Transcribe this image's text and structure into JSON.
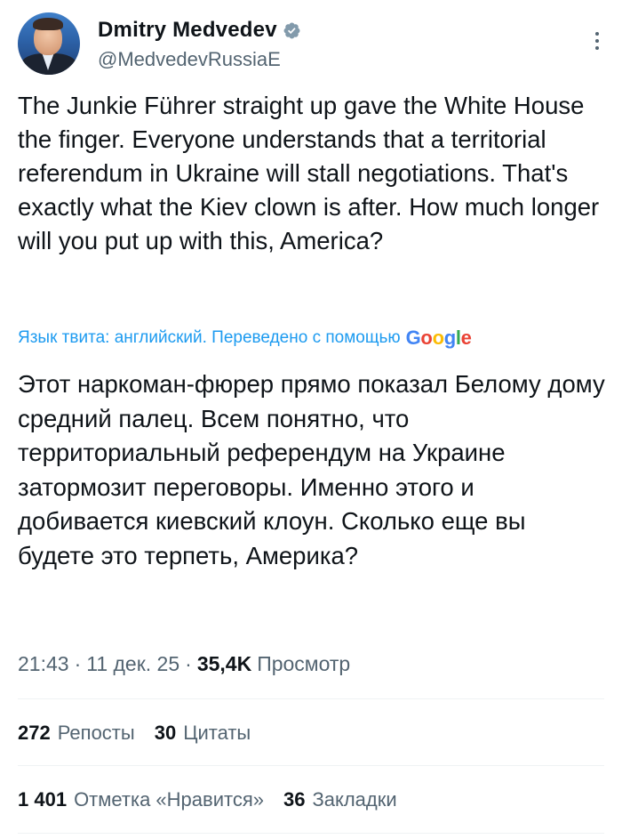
{
  "author": {
    "display_name": "Dmitry Medvedev",
    "handle": "@MedvedevRussiaE",
    "verified": true
  },
  "icons": {
    "avatar": "avatar-photo",
    "verified": "verified-badge-icon",
    "more": "more-options-icon"
  },
  "tweet": {
    "text": "The Junkie Führer straight up gave the White House the finger. Everyone understands that a territorial referendum in Ukraine will stall negotiations. That's exactly what the Kiev clown is after. How much longer will you put up with this, America?",
    "translation_notice": "Язык твита: английский. Переведено с помощью",
    "translation_provider": "Google",
    "translated_text": "Этот наркоман-фюрер прямо показал Белому дому средний палец. Всем понятно, что территориальный референдум на Украине затормозит переговоры. Именно этого и добивается киевский клоун. Сколько еще вы будете это терпеть, Америка?"
  },
  "meta": {
    "time": "21:43",
    "separator": "·",
    "date": "11 дек. 25",
    "views_count": "35,4K",
    "views_label": "Просмотр"
  },
  "stats": {
    "reposts_count": "272",
    "reposts_label": "Репосты",
    "quotes_count": "30",
    "quotes_label": "Цитаты",
    "likes_count": "1 401",
    "likes_label": "Отметка «Нравится»",
    "bookmarks_count": "36",
    "bookmarks_label": "Закладки"
  },
  "colors": {
    "text": "#0f1419",
    "secondary": "#536471",
    "link": "#1d9bf0",
    "divider": "#eff3f4"
  }
}
